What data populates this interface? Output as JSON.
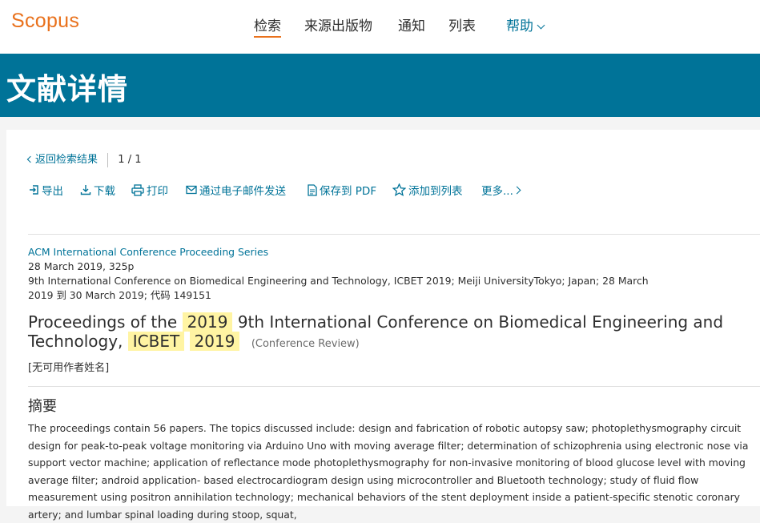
{
  "header": {
    "logo": "Scopus",
    "nav": [
      {
        "label": "检索",
        "active": true
      },
      {
        "label": "来源出版物"
      },
      {
        "label": "通知"
      },
      {
        "label": "列表"
      },
      {
        "label": "帮助"
      }
    ]
  },
  "banner": {
    "title": "文献详情"
  },
  "back": {
    "label": "返回检索结果",
    "pager": "1 / 1"
  },
  "toolbar": {
    "export": "导出",
    "download": "下载",
    "print": "打印",
    "email": "通过电子邮件发送",
    "save_pdf": "保存到 PDF",
    "add_list": "添加到列表",
    "more": "更多..."
  },
  "document": {
    "series": "ACM International Conference Proceeding Series",
    "date_pages": "28 March 2019, 325p",
    "conference_line1": "9th International Conference on Biomedical Engineering and Technology, ICBET 2019; Meiji UniversityTokyo; Japan; 28 March",
    "conference_line2": "2019 到 30 March 2019; 代码 149151",
    "title_part1": "Proceedings of the",
    "title_hl1": "2019",
    "title_part2": "9th International Conference on Biomedical Engineering and Technology,",
    "title_hl2": "ICBET",
    "title_hl3": "2019",
    "doctype": "(Conference Review)",
    "authors": "[无可用作者姓名]"
  },
  "abstract": {
    "heading": "摘要",
    "text": "The proceedings contain 56 papers. The topics discussed include: design and fabrication of robotic autopsy saw; photoplethysmography circuit design for peak-to-peak voltage monitoring via Arduino Uno with moving average filter; determination of schizophrenia using electronic nose via support vector machine; application of reflectance mode photoplethysmography for non-invasive monitoring of blood glucose level with moving average filter; android application- based electrocardiogram design using microcontroller and Bluetooth technology; study of fluid flow measurement using positron annihilation technology; mechanical behaviors of the stent deployment inside a patient-specific stenotic coronary artery; and lumbar spinal loading during stoop, squat,"
  },
  "colors": {
    "brand": "#e9711c",
    "primary": "#007398",
    "highlight": "#fff4a3"
  }
}
